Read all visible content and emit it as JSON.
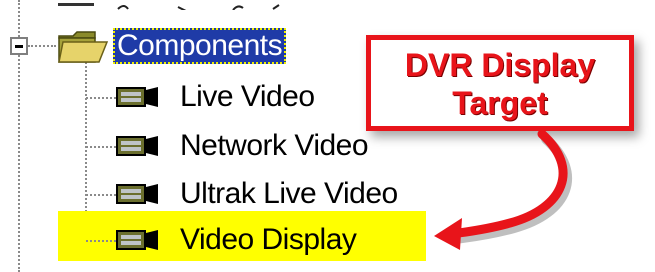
{
  "tree": {
    "folder": {
      "label": "Components",
      "expanded": true,
      "selected": true,
      "icon": "folder-icon"
    },
    "items": [
      {
        "label": "Live Video",
        "icon": "component-icon",
        "highlighted": false
      },
      {
        "label": "Network Video",
        "icon": "component-icon",
        "highlighted": false
      },
      {
        "label": "Ultrak Live Video",
        "icon": "component-icon",
        "highlighted": false
      },
      {
        "label": "Video Display",
        "icon": "component-icon",
        "highlighted": true
      }
    ]
  },
  "callout": {
    "line1": "DVR Display",
    "line2": "Target"
  },
  "colors": {
    "selection_bg": "#1f3ba7",
    "highlight": "#ffff00",
    "callout_accent": "#e8141a"
  }
}
